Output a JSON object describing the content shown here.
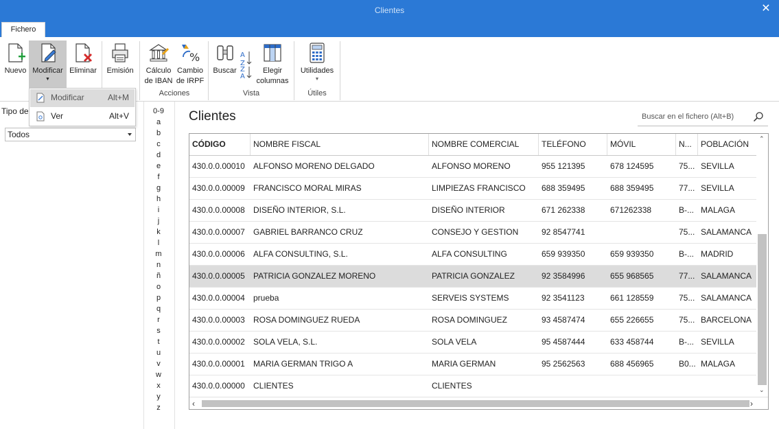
{
  "window": {
    "title": "Clientes",
    "close_glyph": "✕"
  },
  "tabs": {
    "fichero": "Fichero"
  },
  "ribbon": {
    "nuevo": "Nuevo",
    "modificar": "Modificar",
    "eliminar": "Eliminar",
    "emision": "Emisión",
    "calculo_iban_1": "Cálculo",
    "calculo_iban_2": "de IBAN",
    "cambio_irpf_1": "Cambio",
    "cambio_irpf_2": "de IRPF",
    "buscar": "Buscar",
    "elegir_1": "Elegir",
    "elegir_2": "columnas",
    "utilidades": "Utilidades",
    "group_acciones": "Acciones",
    "group_vista": "Vista",
    "group_utiles": "Útiles"
  },
  "dropdown": {
    "items": [
      {
        "label": "Modificar",
        "shortcut": "Alt+M"
      },
      {
        "label": "Ver",
        "shortcut": "Alt+V"
      }
    ]
  },
  "sidebar": {
    "tipo_label": "Tipo de",
    "filter_value": "Todos"
  },
  "alphabet": [
    "0-9",
    "a",
    "b",
    "c",
    "d",
    "e",
    "f",
    "g",
    "h",
    "i",
    "j",
    "k",
    "l",
    "m",
    "n",
    "ñ",
    "o",
    "p",
    "q",
    "r",
    "s",
    "t",
    "u",
    "v",
    "w",
    "x",
    "y",
    "z"
  ],
  "main": {
    "title": "Clientes",
    "search_placeholder": "Buscar en el fichero (Alt+B)"
  },
  "table": {
    "headers": [
      "CÓDIGO",
      "NOMBRE FISCAL",
      "NOMBRE COMERCIAL",
      "TELÉFONO",
      "MÓVIL",
      "N...",
      "POBLACIÓN"
    ],
    "rows": [
      [
        "430.0.0.00010",
        "ALFONSO MORENO DELGADO",
        "ALFONSO MORENO",
        "955 121395",
        "678 124595",
        "75...",
        "SEVILLA"
      ],
      [
        "430.0.0.00009",
        "FRANCISCO MORAL MIRAS",
        "LIMPIEZAS FRANCISCO",
        "688 359495",
        "688 359495",
        "77...",
        "SEVILLA"
      ],
      [
        "430.0.0.00008",
        "DISEÑO INTERIOR, S.L.",
        "DISEÑO INTERIOR",
        "671 262338",
        "671262338",
        "B-...",
        "MALAGA"
      ],
      [
        "430.0.0.00007",
        "GABRIEL BARRANCO CRUZ",
        "CONSEJO Y GESTION",
        "92 8547741",
        "",
        "75...",
        "SALAMANCA"
      ],
      [
        "430.0.0.00006",
        "ALFA CONSULTING, S.L.",
        "ALFA CONSULTING",
        "659 939350",
        "659 939350",
        "B-...",
        "MADRID"
      ],
      [
        "430.0.0.00005",
        "PATRICIA GONZALEZ MORENO",
        "PATRICIA GONZALEZ",
        "92 3584996",
        "655 968565",
        "77...",
        "SALAMANCA"
      ],
      [
        "430.0.0.00004",
        "prueba",
        "SERVEIS SYSTEMS",
        "92 3541123",
        "661 128559",
        "75...",
        "SALAMANCA"
      ],
      [
        "430.0.0.00003",
        "ROSA DOMINGUEZ RUEDA",
        "ROSA DOMINGUEZ",
        "93 4587474",
        "655 226655",
        "75...",
        "BARCELONA"
      ],
      [
        "430.0.0.00002",
        "SOLA VELA, S.L.",
        "SOLA VELA",
        "95 4587444",
        "633 458744",
        "B-...",
        "SEVILLA"
      ],
      [
        "430.0.0.00001",
        "MARIA GERMAN TRIGO A",
        "MARIA GERMAN",
        "95 2562563",
        "688 456965",
        "B0...",
        "MALAGA"
      ],
      [
        "430.0.0.00000",
        "CLIENTES",
        "CLIENTES",
        "",
        "",
        "",
        ""
      ]
    ],
    "selected_row": 5
  },
  "colors": {
    "titlebar": "#2b79d6",
    "selected_row": "#dcdcdc",
    "accent_green": "#1f9d3a",
    "accent_red": "#d42a2a"
  },
  "icons": [
    "new-document-icon",
    "edit-document-icon",
    "delete-document-icon",
    "print-icon",
    "bank-icon",
    "percent-icon",
    "binoculars-icon",
    "sort-icon",
    "columns-icon",
    "calculator-icon",
    "search-icon"
  ]
}
